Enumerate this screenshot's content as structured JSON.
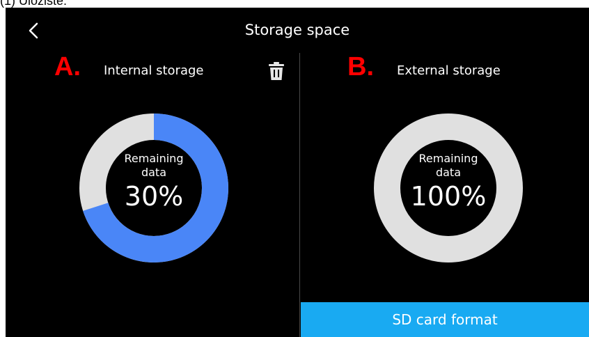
{
  "caption": "(1)  Úložiště:",
  "header": {
    "title": "Storage space"
  },
  "internal": {
    "marker": "A.",
    "title": "Internal storage",
    "remaining_label": "Remaining\ndata",
    "remaining_value": "30%",
    "remaining_fraction": 0.7,
    "used_color": "#4a86f7",
    "free_color": "#e0e0e0"
  },
  "external": {
    "marker": "B.",
    "title": "External storage",
    "remaining_label": "Remaining\ndata",
    "remaining_value": "100%",
    "ring_color": "#e0e0e0"
  },
  "footer": {
    "sd_format_label": "SD card format",
    "button_color": "#19aaf2"
  }
}
